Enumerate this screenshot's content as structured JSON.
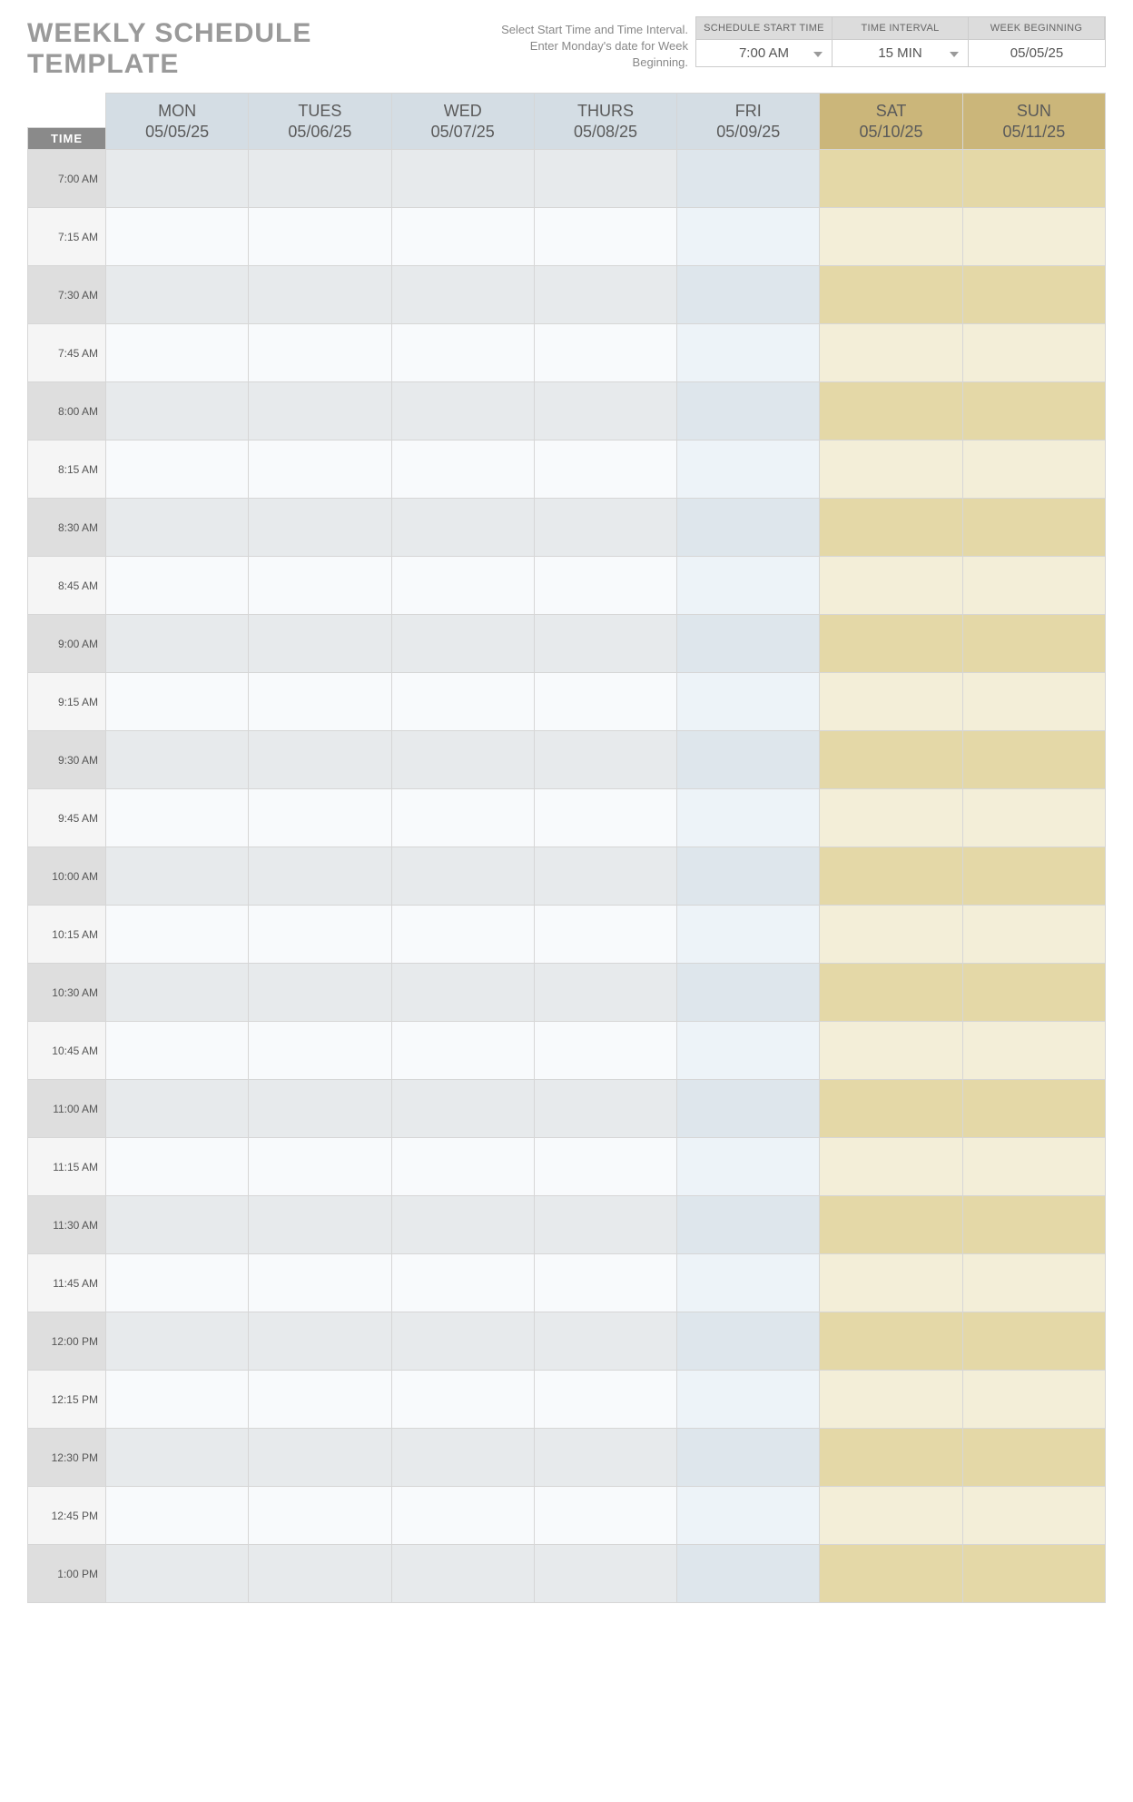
{
  "header": {
    "title": "WEEKLY SCHEDULE TEMPLATE",
    "instructions_l1": "Select Start Time and Time Interval.",
    "instructions_l2": "Enter Monday's date for Week Beginning."
  },
  "config": {
    "start_time_label": "SCHEDULE START TIME",
    "interval_label": "TIME INTERVAL",
    "week_begin_label": "WEEK BEGINNING",
    "start_time_value": "7:00 AM",
    "interval_value": "15 MIN",
    "week_begin_value": "05/05/25"
  },
  "grid": {
    "time_header": "TIME",
    "days": [
      {
        "name": "MON",
        "date": "05/05/25",
        "type": "wk"
      },
      {
        "name": "TUES",
        "date": "05/06/25",
        "type": "wk"
      },
      {
        "name": "WED",
        "date": "05/07/25",
        "type": "wk"
      },
      {
        "name": "THURS",
        "date": "05/08/25",
        "type": "wk"
      },
      {
        "name": "FRI",
        "date": "05/09/25",
        "type": "fr"
      },
      {
        "name": "SAT",
        "date": "05/10/25",
        "type": "we"
      },
      {
        "name": "SUN",
        "date": "05/11/25",
        "type": "we"
      }
    ],
    "times": [
      "7:00 AM",
      "7:15 AM",
      "7:30 AM",
      "7:45 AM",
      "8:00 AM",
      "8:15 AM",
      "8:30 AM",
      "8:45 AM",
      "9:00 AM",
      "9:15 AM",
      "9:30 AM",
      "9:45 AM",
      "10:00 AM",
      "10:15 AM",
      "10:30 AM",
      "10:45 AM",
      "11:00 AM",
      "11:15 AM",
      "11:30 AM",
      "11:45 AM",
      "12:00 PM",
      "12:15 PM",
      "12:30 PM",
      "12:45 PM",
      "1:00 PM"
    ]
  }
}
